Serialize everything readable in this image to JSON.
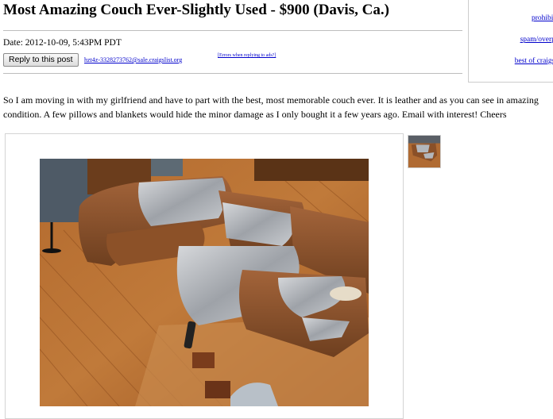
{
  "posting": {
    "title": "Most Amazing Couch Ever-Slightly Used - $900 (Davis, Ca.)",
    "date": "Date: 2012-10-09, 5:43PM PDT",
    "reply_button": "Reply to this post",
    "reply_email": "hzt4z-3328273762@sale.craigslist.org",
    "errors_link": "[Errors when replying to ads?]",
    "body": "So I am moving in with my girlfriend and have to part with the best, most memorable couch ever. It is leather and as you can see in amazing condition. A few pillows and blankets would hide the minor damage as I only bought it a few years ago. Email with interest! Cheers"
  },
  "sidebar": {
    "links": [
      "prohibited",
      "spam/overpost",
      "best of craigslist"
    ]
  },
  "colors": {
    "link": "#0000cc",
    "rule": "#bdbdbd"
  }
}
